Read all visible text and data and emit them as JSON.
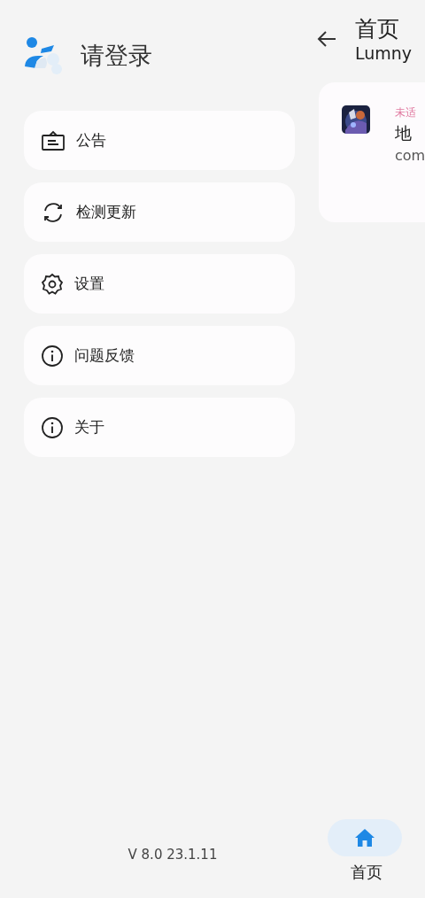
{
  "drawer": {
    "title": "请登录",
    "items": [
      {
        "kind": "notice",
        "label": "公告"
      },
      {
        "kind": "refresh",
        "label": "检测更新"
      },
      {
        "kind": "settings",
        "label": "设置"
      },
      {
        "kind": "info",
        "label": "问题反馈"
      },
      {
        "kind": "info",
        "label": "关于"
      }
    ],
    "version": "V 8.0 23.1.11"
  },
  "page": {
    "title": "首页",
    "subtitle": "Lumny",
    "app_card": {
      "tag": "未适",
      "name": "地",
      "package": "com"
    },
    "bottom_nav": [
      {
        "label": "首页",
        "selected": true
      }
    ]
  }
}
